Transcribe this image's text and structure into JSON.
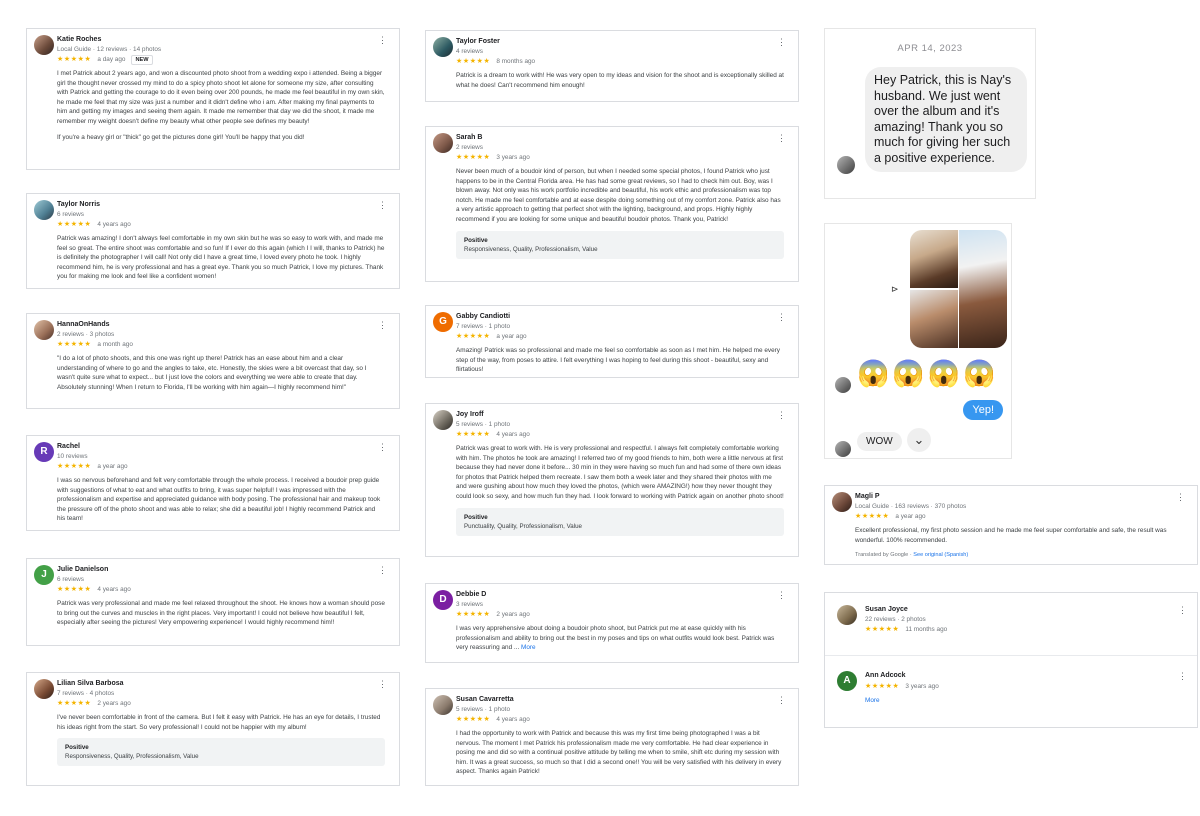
{
  "reviews": {
    "katie": {
      "name": "Katie Roches",
      "meta": "Local Guide · 12 reviews · 14 photos",
      "time": "a day ago",
      "badge": "NEW",
      "p1": "I met Patrick about 2 years ago, and won a discounted photo shoot from a wedding expo i attended. Being a bigger girl the thought never crossed my mind to do a spicy photo shoot let alone for someone my size, after consulting with Patrick and getting the courage to do it even being over 200 pounds, he made me feel beautiful in my own skin, he made me feel that my size was just a number and it didn't define who i am. After making my final payments to him and getting my images and seeing them again. It made me remember that day we did the shoot, it made me remember my weight doesn't define my beauty what other people see defines my beauty!",
      "p2": "If you're a heavy girl or \"thick\" go get the pictures done girl! You'll be happy that you did!"
    },
    "taylor_norris": {
      "name": "Taylor Norris",
      "meta": "6 reviews",
      "time": "4 years ago",
      "text": "Patrick was amazing! I don't always feel comfortable in my own skin but he was so easy to work with, and made me feel so great. The entire shoot was comfortable and so fun! If I ever do this again (which I I will, thanks to Patrick) he is definitely the photographer I will call! Not only did I have a great time, I loved every photo he took. I highly recommend him, he is very professional and has a great eye. Thank you so much Patrick, I love my pictures. Thank you for making me look and feel like a confident women!"
    },
    "hanna": {
      "name": "HannaOnHands",
      "meta": "2 reviews · 3 photos",
      "time": "a month ago",
      "text": "\"I do a lot of photo shoots, and this one was right up there! Patrick has an ease about him and a clear understanding of where to go and the angles to take, etc. Honestly, the skies were a bit overcast that day, so I wasn't quite sure what to expect... but I just love the colors and everything we were able to create that day. Absolutely stunning! When I return to Florida, I'll be working with him again—I highly recommend him!\""
    },
    "rachel": {
      "name": "Rachel",
      "meta": "10 reviews",
      "time": "a year ago",
      "initial": "R",
      "text": "I was so nervous beforehand and felt very comfortable through the whole process. I received a boudoir prep guide with suggestions of what to eat and what outfits to bring, it was super helpful! I was impressed with the professionalism and expertise and appreciated guidance with body posing. The professional hair and makeup took the pressure off of the photo shoot and was able to relax; she did a beautiful job! I highly recommend Patrick and his team!"
    },
    "julie": {
      "name": "Julie Danielson",
      "meta": "6 reviews",
      "time": "4 years ago",
      "initial": "J",
      "text": "Patrick was very professional and made me feel relaxed throughout the shoot. He knows how a woman should pose to bring out the curves and muscles in the right places. Very important! I could not believe how beautiful I felt, especially after seeing the pictures! Very empowering experience! I would highly recommend him!!"
    },
    "lilian": {
      "name": "Lilian Silva Barbosa",
      "meta": "7 reviews · 4 photos",
      "time": "2 years ago",
      "text": "I've never been comfortable in front of the camera. But I felt it easy with Patrick. He has an eye for details, I trusted his ideas right from the start. So very professional! I could not be happier with my album!",
      "pos_title": "Positive",
      "pos_values": "Responsiveness, Quality, Professionalism, Value"
    },
    "taylor_foster": {
      "name": "Taylor Foster",
      "meta": "4 reviews",
      "time": "8 months ago",
      "text": "Patrick is a dream to work with! He was very open to my ideas and vision for the shoot and is exceptionally skilled at what he does! Can't recommend him enough!"
    },
    "sarah": {
      "name": "Sarah B",
      "meta": "2 reviews",
      "time": "3 years ago",
      "text": "Never been much of a boudoir kind of person, but when I needed some special photos, I found Patrick who just happens to be in the Central Florida area. He has had some great reviews, so I had to check him out. Boy, was I blown away. Not only was his work portfolio incredible and beautiful, his work ethic and professionalism was top notch. He made me feel comfortable and at ease despite doing something out of my comfort zone. Patrick also has a very artistic approach to getting that perfect shot with the lighting, background, and props. Highly highly recommend if you are looking for some unique and beautiful boudoir photos. Thank you, Patrick!",
      "pos_title": "Positive",
      "pos_values": "Responsiveness, Quality, Professionalism, Value"
    },
    "gabby": {
      "name": "Gabby Candiotti",
      "meta": "7 reviews · 1 photo",
      "time": "a year ago",
      "initial": "G",
      "text": "Amazing! Patrick was so professional and made me feel so comfortable as soon as I met him. He helped me every step of the way, from poses to attire. I felt everything I was hoping to feel during this shoot - beautiful, sexy and flirtatious!"
    },
    "joy": {
      "name": "Joy Iroff",
      "meta": "5 reviews · 1 photo",
      "time": "4 years ago",
      "text": "Patrick was great to work with. He is very professional and respectful. I always felt completely comfortable working with him. The photos he took are amazing! I referred two of my good friends to him, both were a little nervous at first because they had never done it before... 30 min in they were having so much fun and had some of there own ideas for photos that Patrick helped them recreate. I saw them both a week later and they shared their photos with me and were gushing about how much they loved the photos, (which were AMAZING!) how they never thought they could look so sexy, and how much fun they had. I look forward to working with Patrick again on another photo shoot!",
      "pos_title": "Positive",
      "pos_values": "Punctuality, Quality, Professionalism, Value"
    },
    "debbie": {
      "name": "Debbie D",
      "meta": "3 reviews",
      "time": "2 years ago",
      "initial": "D",
      "text": "I was very apprehensive about doing a boudoir photo shoot, but Patrick put me at ease quickly with his professionalism and ability to bring out the best in my poses and tips on what outfits would look best. Patrick was very reassuring and ...",
      "more": "More"
    },
    "susan_c": {
      "name": "Susan Cavarretta",
      "meta": "5 reviews · 1 photo",
      "time": "4 years ago",
      "text": "I had the opportunity to work with Patrick and because this was my first time being photographed I was a bit nervous. The moment I met Patrick his professionalism made me very comfortable. He had clear experience in posing me and did so with a continual positive attitude by telling me when to smile, shift etc during my session with him. It was a great success, so much so that I did a second one!! You will be very satisfied with his delivery in every aspect. Thanks again Patrick!"
    },
    "magli": {
      "name": "Magli P",
      "meta": "Local Guide · 163 reviews · 370 photos",
      "time": "a year ago",
      "text": "Excellent professional, my first photo session and he made me feel super comfortable and safe, the result was wonderful. 100% recommended.",
      "translated": "Translated by Google · ",
      "see_original": "See original (Spanish)"
    },
    "susan_joyce": {
      "name": "Susan Joyce",
      "meta": "22 reviews · 2 photos",
      "time": "11 months ago"
    },
    "ann": {
      "name": "Ann Adcock",
      "time": "3 years ago",
      "initial": "A",
      "more": "More"
    }
  },
  "stars": "★★★★★",
  "kebab": "⋮",
  "chat": {
    "date": "APR 14, 2023",
    "message": "Hey Patrick, this is Nay's husband. We just went over the album and it's amazing! Thank you so much for giving her such a positive experience.",
    "heart": "♥",
    "emojis": "😱😱😱😱",
    "reply": "Yep!",
    "wow": "WOW",
    "chevron": "⌄",
    "share": "⊳"
  },
  "colors": {
    "star": "#f4b400",
    "link": "#1a73e8",
    "rachel": "#673ab7",
    "julie": "#43a047",
    "gabby": "#ef6c00",
    "debbie": "#7b1fa2",
    "ann": "#2e7d32",
    "reply": "#3797f0"
  }
}
